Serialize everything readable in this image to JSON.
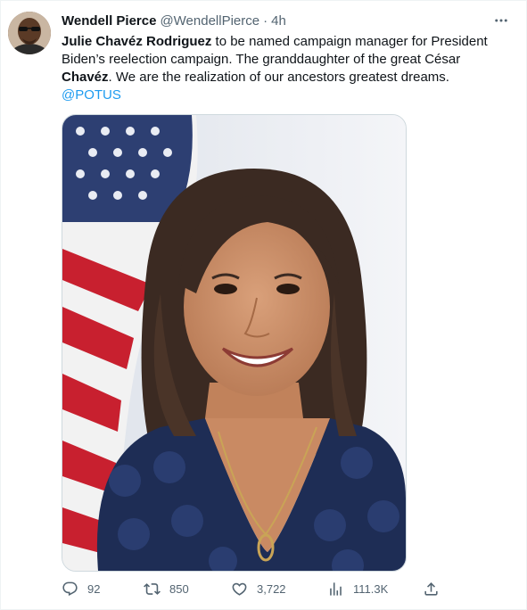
{
  "tweet": {
    "display_name": "Wendell Pierce",
    "handle": "@WendellPierce",
    "separator": "·",
    "time": "4h",
    "more_label": "···",
    "text": {
      "line1_bold": "Julie Chavéz Rodriguez",
      "line1_rest": " to be named campaign manager for President",
      "line2": "Biden’s reelection campaign. The granddaughter of the great César",
      "line3_bold": "Chavéz",
      "line3_rest": ". We are the realization of our ancestors greatest dreams.",
      "mention": "@POTUS"
    },
    "image_alt": "Portrait of a smiling woman with shoulder-length dark hair in front of an American flag",
    "stats": {
      "replies": "92",
      "retweets": "850",
      "likes": "3,722",
      "views": "111.3K"
    },
    "icons": {
      "reply": "reply-icon",
      "retweet": "retweet-icon",
      "like": "heart-icon",
      "views": "analytics-icon",
      "share": "share-icon",
      "more": "more-icon"
    },
    "colors": {
      "link": "#1d9bf0",
      "secondary_text": "#536471",
      "primary_text": "#0f1419",
      "border": "#cfd9de"
    }
  }
}
